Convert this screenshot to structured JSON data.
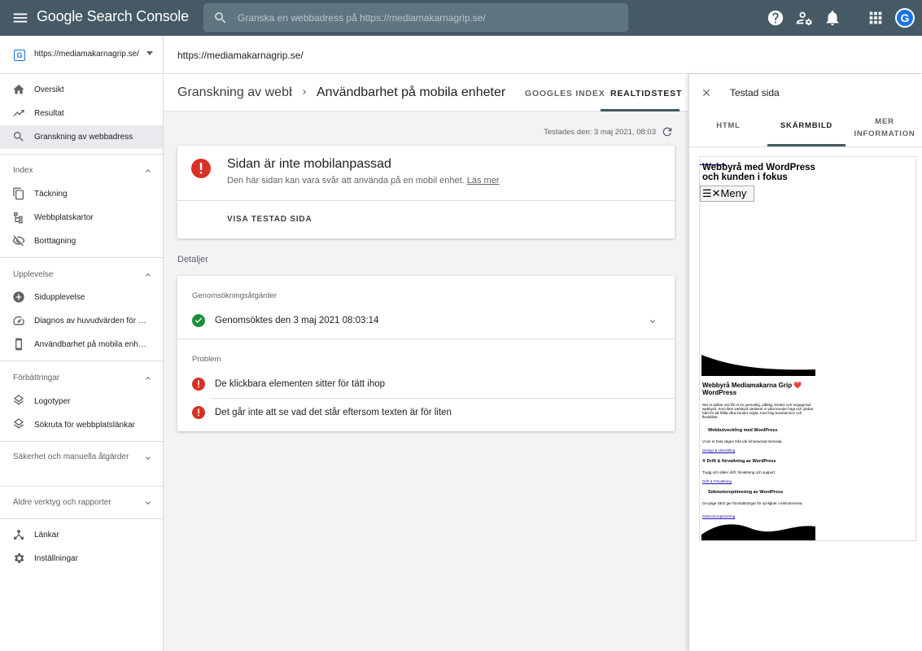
{
  "app": {
    "logo_text": "Google Search Console",
    "search_placeholder": "Granska en webbadress på https://mediamakarnagrip.se/",
    "avatar_initial": "G"
  },
  "sidebar": {
    "property": "https://mediamakarnagrip.se/",
    "top_items": [
      {
        "label": "Översikt",
        "icon": "home-icon"
      },
      {
        "label": "Resultat",
        "icon": "trending-icon"
      },
      {
        "label": "Granskning av webbadress",
        "icon": "search-icon"
      }
    ],
    "sections": [
      {
        "title": "Index",
        "items": [
          {
            "label": "Täckning",
            "icon": "copy-icon"
          },
          {
            "label": "Webbplatskartor",
            "icon": "sitemap-icon"
          },
          {
            "label": "Borttagning",
            "icon": "visibility-off-icon"
          }
        ]
      },
      {
        "title": "Upplevelse",
        "items": [
          {
            "label": "Sidupplevelse",
            "icon": "plus-circle-icon"
          },
          {
            "label": "Diagnos av huvudvärden för webben",
            "icon": "speed-icon"
          },
          {
            "label": "Användbarhet på mobila enheter",
            "icon": "phone-icon"
          }
        ]
      },
      {
        "title": "Förbättringar",
        "items": [
          {
            "label": "Logotyper",
            "icon": "layers-icon"
          },
          {
            "label": "Sökruta för webbplatslänkar",
            "icon": "layers-icon"
          }
        ]
      },
      {
        "title": "Säkerhet och manuella åtgärder",
        "items": []
      },
      {
        "title": "Äldre verktyg och rapporter",
        "items": []
      }
    ],
    "bottom_items": [
      {
        "label": "Länkar",
        "icon": "links-icon"
      },
      {
        "label": "Inställningar",
        "icon": "settings-icon"
      }
    ]
  },
  "urlbar": {
    "url": "https://mediamakarnagrip.se/"
  },
  "main": {
    "breadcrumb_1": "Granskning av webbadress",
    "breadcrumb_2": "Användbarhet på mobila enheter",
    "tabs": [
      "GOOGLES INDEX",
      "REALTIDSTEST"
    ],
    "active_tab": "REALTIDSTEST",
    "tested_on": "Testades den: 3 maj 2021, 08:03",
    "result_title": "Sidan är inte mobilanpassad",
    "result_desc": "Den här sidan kan vara svår att använda på en mobil enhet.",
    "learn_more": "Läs mer",
    "view_tested": "VISA TESTAD SIDA",
    "details_label": "Detaljer",
    "crawl_section": "Genomsökningsåtgärder",
    "crawl_row": "Genomsöktes den 3 maj 2021 08:03:14",
    "problem_section": "Problem",
    "problems": [
      "De klickbara elementen sitter för tätt ihop",
      "Det går inte att se vad det står eftersom texten är för liten"
    ]
  },
  "panel": {
    "title": "Testad sida",
    "tabs": [
      "HTML",
      "SKÄRMBILD",
      "MER INFORMATION"
    ],
    "active_tab": "SKÄRMBILD",
    "shot": {
      "site_title": "Webbyrå med WordPress och kunden i fokus",
      "menu_label": "☰✕Meny",
      "heading": "Webbyrå Mediamakarna Grip ❤️ WordPress",
      "intro": "När ni anlitar oss får ni en personlig, pålitlig, kreativ och engagerad webbyrå. Som liten webbyrå värderar vi våra kunder högt och jobbar hårt för att hålla våra kunder nöjda, med hög kundservice och flexibilitet.",
      "s1_title": "Webbutveckling med WordPress",
      "s1_text": "Vi tar er hela vägen från idé till lanserad hemsida.",
      "s1_link": "Design & Utveckling",
      "s2_title": "® Drift & förvaltning av WordPress",
      "s2_text": "Trygg och säker drift, förvaltning och support.",
      "s2_link": "Drift & Förvaltning",
      "s3_title": "Sökmotoroptimering av WordPress",
      "s3_text": "On-page SEO ger förutsättningar för synlighet i sökmotorerna.",
      "s3_link": "Sökmotoroptimering"
    }
  },
  "colors": {
    "topbar": "#455a64",
    "error": "#d93025",
    "success": "#1e8e3e",
    "active_nav": "#e8eaed"
  }
}
